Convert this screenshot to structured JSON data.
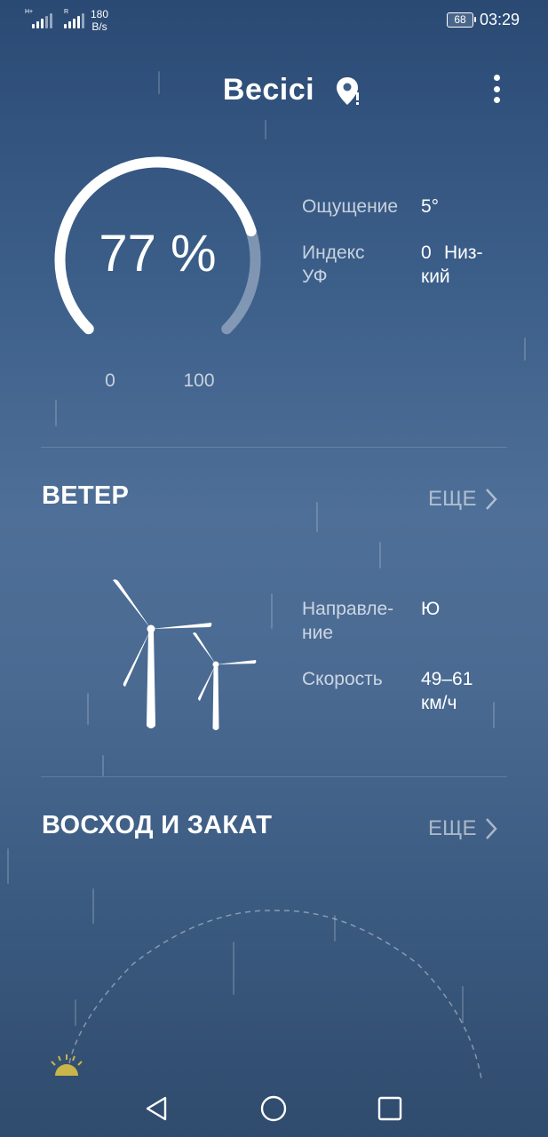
{
  "status_bar": {
    "sim1_tag": "H+",
    "sim2_tag": "R",
    "net_speed_value": "180",
    "net_speed_unit": "B/s",
    "battery": "68",
    "time": "03:29"
  },
  "header": {
    "location": "Becici",
    "location_icon": "location-pin-icon",
    "menu_icon": "more-vertical-icon"
  },
  "humidity": {
    "value_text": "77 %",
    "value": 77,
    "min_label": "0",
    "max_label": "100"
  },
  "details": {
    "feels_like_label": "Ощущение",
    "feels_like_value": "5°",
    "uv_label_1": "Индекс",
    "uv_label_2": "УФ",
    "uv_value_number": "0",
    "uv_value_text_1": "Низ-",
    "uv_value_text_2": "кий"
  },
  "wind": {
    "title": "ВЕТЕР",
    "more_label": "ЕЩЕ",
    "direction_label_1": "Направле-",
    "direction_label_2": "ние",
    "direction_value": "Ю",
    "speed_label": "Скорость",
    "speed_value_1": "49–61",
    "speed_value_2": "км/ч",
    "icon": "wind-turbines-icon"
  },
  "sun": {
    "title": "ВОСХОД И ЗАКАТ",
    "more_label": "ЕЩЕ",
    "icon": "sun-icon"
  },
  "navbar": {
    "back_icon": "back-triangle-icon",
    "home_icon": "home-circle-icon",
    "recents_icon": "recents-square-icon"
  },
  "colors": {
    "background_top": "#2a4a74",
    "background_mid": "#4e6f97",
    "background_bottom": "#2f4b6d",
    "sun": "#c9b54a"
  }
}
